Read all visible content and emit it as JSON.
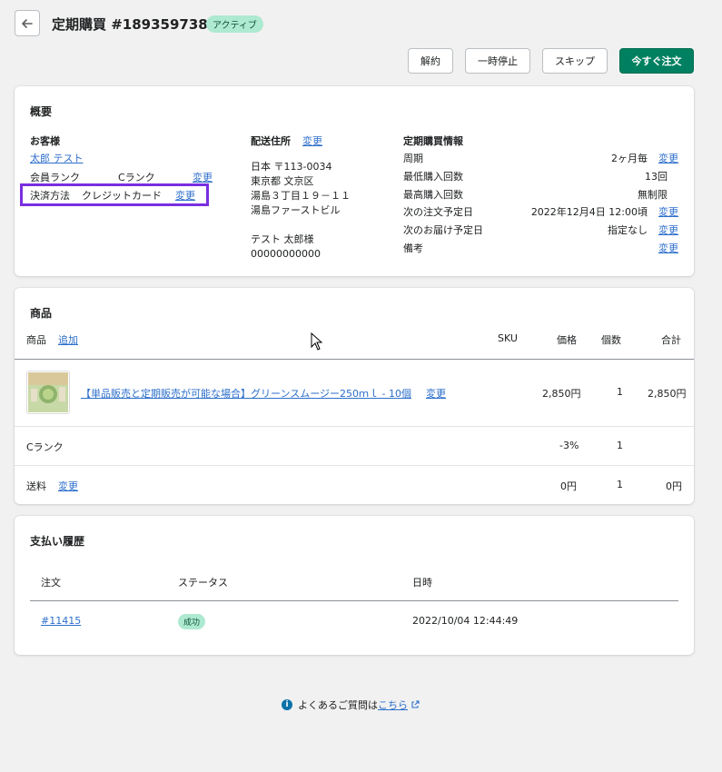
{
  "header": {
    "title": "定期購買 #1893597389",
    "status_badge": "アクティブ"
  },
  "actions": {
    "cancel": "解約",
    "pause": "一時停止",
    "skip": "スキップ",
    "order_now": "今すぐ注文"
  },
  "summary": {
    "title": "概要",
    "customer": {
      "label": "お客様",
      "name": "太郎 テスト",
      "rank_label": "会員ランク",
      "rank_value": "Cランク",
      "rank_change": "変更",
      "payment_label": "決済方法",
      "payment_value": "クレジットカード",
      "payment_change": "変更"
    },
    "shipping": {
      "label": "配送住所",
      "change": "変更",
      "lines": [
        "日本 〒113-0034",
        "東京都 文京区",
        "湯島３丁目１９－１１",
        "湯島ファーストビル"
      ],
      "recipient": "テスト 太郎様",
      "phone": "00000000000"
    },
    "subscription": {
      "label": "定期購買情報",
      "rows": [
        {
          "label": "周期",
          "value": "2ヶ月毎",
          "change": "変更"
        },
        {
          "label": "最低購入回数",
          "value": "13回",
          "change": ""
        },
        {
          "label": "最高購入回数",
          "value": "無制限",
          "change": ""
        },
        {
          "label": "次の注文予定日",
          "value": "2022年12月4日 12:00頃",
          "change": "変更"
        },
        {
          "label": "次のお届け予定日",
          "value": "指定なし",
          "change": "変更"
        },
        {
          "label": "備考",
          "value": "",
          "change": "変更"
        }
      ]
    }
  },
  "products": {
    "title": "商品",
    "headers": {
      "product": "商品",
      "add": "追加",
      "sku": "SKU",
      "price": "価格",
      "qty": "個数",
      "total": "合計"
    },
    "item": {
      "name": "【単品販売と定期販売が可能な場合】グリーンスムージー250ｍｌ - 10個",
      "change": "変更",
      "price": "2,850円",
      "qty": "1",
      "total": "2,850円"
    },
    "discount": {
      "label": "Cランク",
      "price": "-3%",
      "qty": "1"
    },
    "shipping": {
      "label": "送料",
      "change": "変更",
      "price": "0円",
      "qty": "1",
      "total": "0円"
    }
  },
  "payments": {
    "title": "支払い履歴",
    "headers": {
      "order": "注文",
      "status": "ステータス",
      "date": "日時"
    },
    "rows": [
      {
        "order": "#11415",
        "status": "成功",
        "date": "2022/10/04 12:44:49"
      }
    ]
  },
  "footer": {
    "text": "よくあるご質問は",
    "link": "こちら"
  },
  "colors": {
    "primary": "#008060",
    "link": "#2c6ecb",
    "badge_bg": "#aee9d1",
    "highlight": "#7a2ee0"
  }
}
